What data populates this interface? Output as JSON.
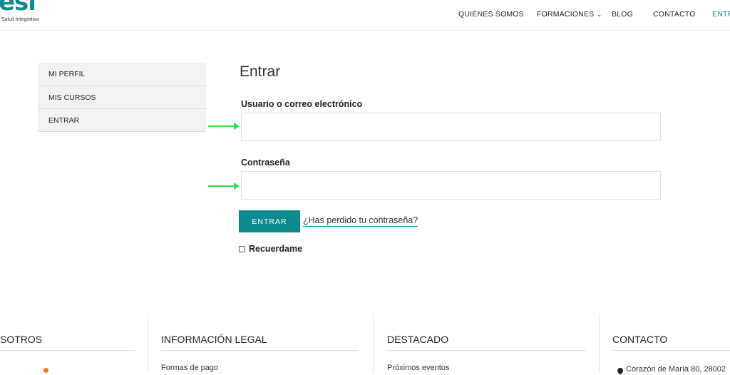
{
  "header": {
    "logo_text": "esi",
    "logo_subtitle": "Salud Integrativa",
    "nav": [
      {
        "label": "QUIÉNES SOMOS"
      },
      {
        "label": "FORMACIONES"
      },
      {
        "label": "BLOG"
      },
      {
        "label": "CONTACTO"
      },
      {
        "label": "ENTR"
      }
    ]
  },
  "sidebar": {
    "items": [
      {
        "label": "MI PERFIL"
      },
      {
        "label": "MIS CURSOS"
      },
      {
        "label": "ENTRAR"
      }
    ]
  },
  "form": {
    "title": "Entrar",
    "username_label": "Usuario o correo electrónico",
    "username_value": "",
    "password_label": "Contraseña",
    "password_value": "",
    "submit_label": "ENTRAR",
    "lost_password_label": "¿Has perdido tu contraseña?",
    "remember_label": "Recuerdame",
    "remember_checked": false
  },
  "annotations": {
    "arrow_color": "#2ee24a"
  },
  "footer": {
    "columns": [
      {
        "title": "SOTROS",
        "link": ""
      },
      {
        "title": "INFORMACIÓN LEGAL",
        "link": "Formas de pago"
      },
      {
        "title": "DESTACADO",
        "link": "Próximos eventos"
      },
      {
        "title": "CONTACTO",
        "link": "Corazón de María 80, 28002"
      }
    ]
  },
  "colors": {
    "accent": "#0e8a8f",
    "dot": "#ef7d1a"
  }
}
